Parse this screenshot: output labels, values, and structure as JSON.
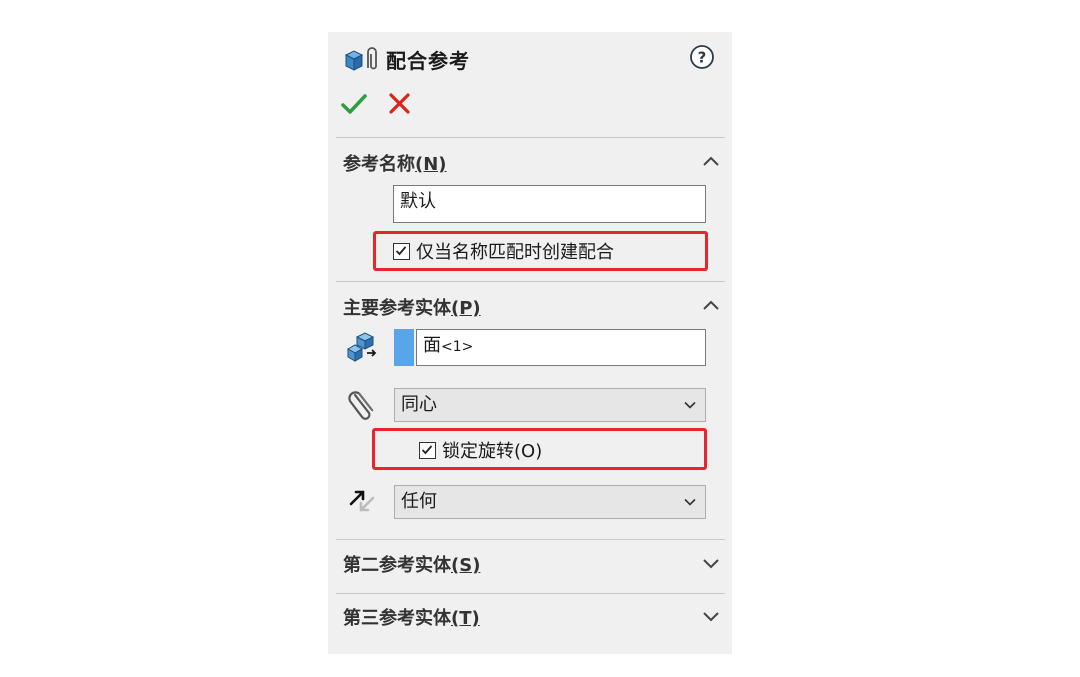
{
  "panel": {
    "title": "配合参考",
    "icons": {
      "title": "mate-reference-icon",
      "help": "help-icon",
      "ok": "checkmark-icon",
      "cancel": "close-icon"
    }
  },
  "reference_name": {
    "header": "参考名称",
    "accel": "(N)",
    "value": "默认",
    "checkbox_label": "仅当名称匹配时创建配合",
    "checkbox_checked": true
  },
  "primary_entity": {
    "header": "主要参考实体",
    "accel": "(P)",
    "entity_name": "面",
    "entity_index": "<1>",
    "mate_type": "同心",
    "lock_rotation_label": "锁定旋转",
    "lock_rotation_accel": "(O)",
    "lock_rotation_checked": true,
    "alignment": "任何"
  },
  "secondary_entity": {
    "header": "第二参考实体",
    "accel": "(S)"
  },
  "tertiary_entity": {
    "header": "第三参考实体",
    "accel": "(T)"
  },
  "colors": {
    "highlight": "#e8242c",
    "swatch": "#5aa5ea",
    "ok": "#2e9e3f",
    "cancel": "#d9261c"
  }
}
